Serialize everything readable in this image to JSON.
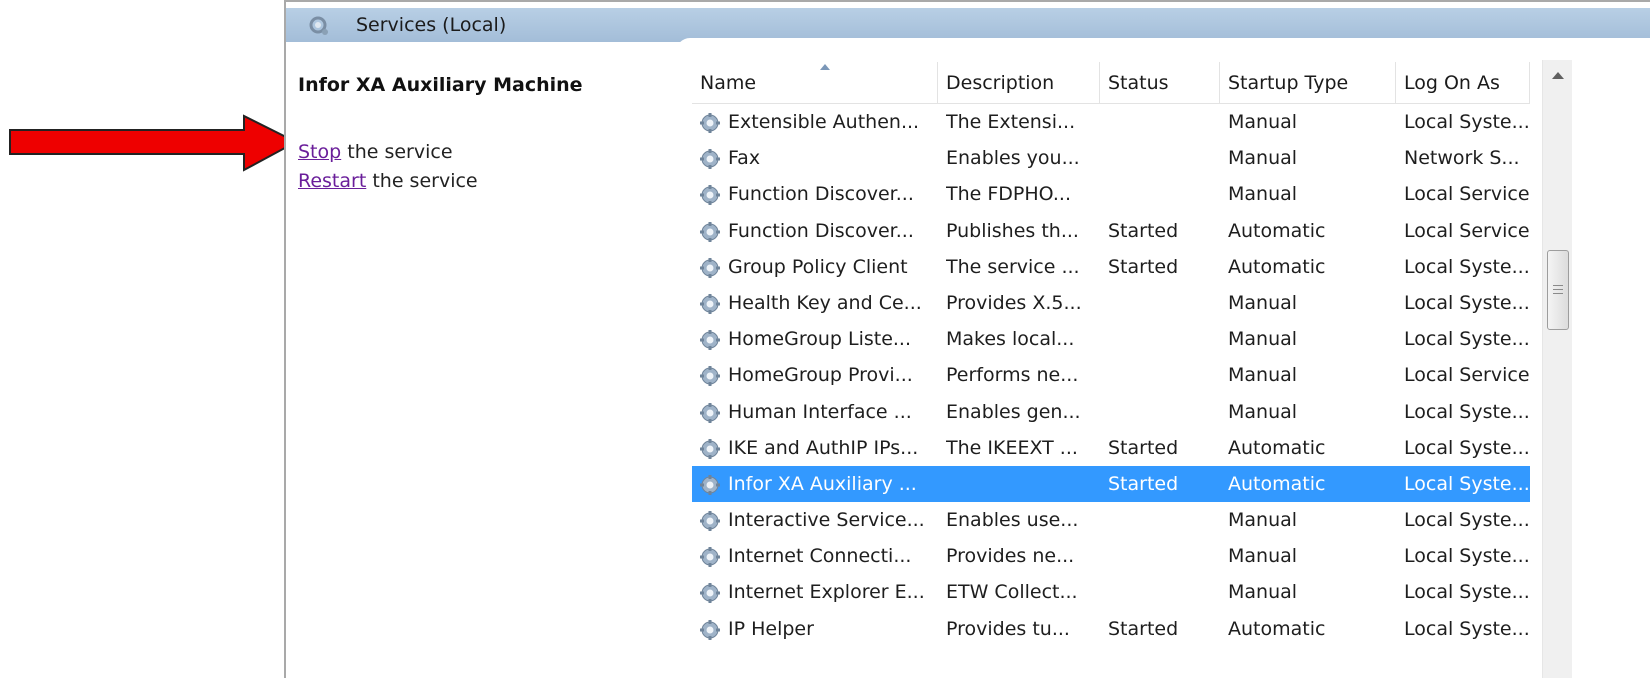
{
  "header": {
    "title": "Services (Local)"
  },
  "left_pane": {
    "title": "Infor XA Auxiliary Machine",
    "stop_link": "Stop",
    "stop_suffix": " the service",
    "restart_link": "Restart",
    "restart_suffix": " the service"
  },
  "table": {
    "columns": [
      "Name",
      "Description",
      "Status",
      "Startup Type",
      "Log On As"
    ],
    "rows": [
      {
        "name": "Extensible Authen...",
        "description": "The Extensi...",
        "status": "",
        "startup": "Manual",
        "logon": "Local Syste..."
      },
      {
        "name": "Fax",
        "description": "Enables you...",
        "status": "",
        "startup": "Manual",
        "logon": "Network S..."
      },
      {
        "name": "Function Discover...",
        "description": "The FDPHO...",
        "status": "",
        "startup": "Manual",
        "logon": "Local Service"
      },
      {
        "name": "Function Discover...",
        "description": "Publishes th...",
        "status": "Started",
        "startup": "Automatic",
        "logon": "Local Service"
      },
      {
        "name": "Group Policy Client",
        "description": "The service ...",
        "status": "Started",
        "startup": "Automatic",
        "logon": "Local Syste..."
      },
      {
        "name": "Health Key and Ce...",
        "description": "Provides X.5...",
        "status": "",
        "startup": "Manual",
        "logon": "Local Syste..."
      },
      {
        "name": "HomeGroup Liste...",
        "description": "Makes local...",
        "status": "",
        "startup": "Manual",
        "logon": "Local Syste..."
      },
      {
        "name": "HomeGroup Provi...",
        "description": "Performs ne...",
        "status": "",
        "startup": "Manual",
        "logon": "Local Service"
      },
      {
        "name": "Human Interface ...",
        "description": "Enables gen...",
        "status": "",
        "startup": "Manual",
        "logon": "Local Syste..."
      },
      {
        "name": "IKE and AuthIP IPs...",
        "description": "The IKEEXT ...",
        "status": "Started",
        "startup": "Automatic",
        "logon": "Local Syste..."
      },
      {
        "name": "Infor XA Auxiliary ...",
        "description": "",
        "status": "Started",
        "startup": "Automatic",
        "logon": "Local Syste...",
        "selected": true
      },
      {
        "name": "Interactive Service...",
        "description": "Enables use...",
        "status": "",
        "startup": "Manual",
        "logon": "Local Syste..."
      },
      {
        "name": "Internet Connecti...",
        "description": "Provides ne...",
        "status": "",
        "startup": "Manual",
        "logon": "Local Syste..."
      },
      {
        "name": "Internet Explorer E...",
        "description": "ETW Collect...",
        "status": "",
        "startup": "Manual",
        "logon": "Local Syste..."
      },
      {
        "name": "IP Helper",
        "description": "Provides tu...",
        "status": "Started",
        "startup": "Automatic",
        "logon": "Local Syste..."
      }
    ]
  },
  "icons": {
    "header": "services-icon",
    "row": "gear-icon",
    "annotation": "red-arrow-icon"
  },
  "colors": {
    "selection": "#3399ff",
    "link": "#6a1e9a",
    "arrow": "#ee0000",
    "header_bar": "#a3bdd8"
  }
}
